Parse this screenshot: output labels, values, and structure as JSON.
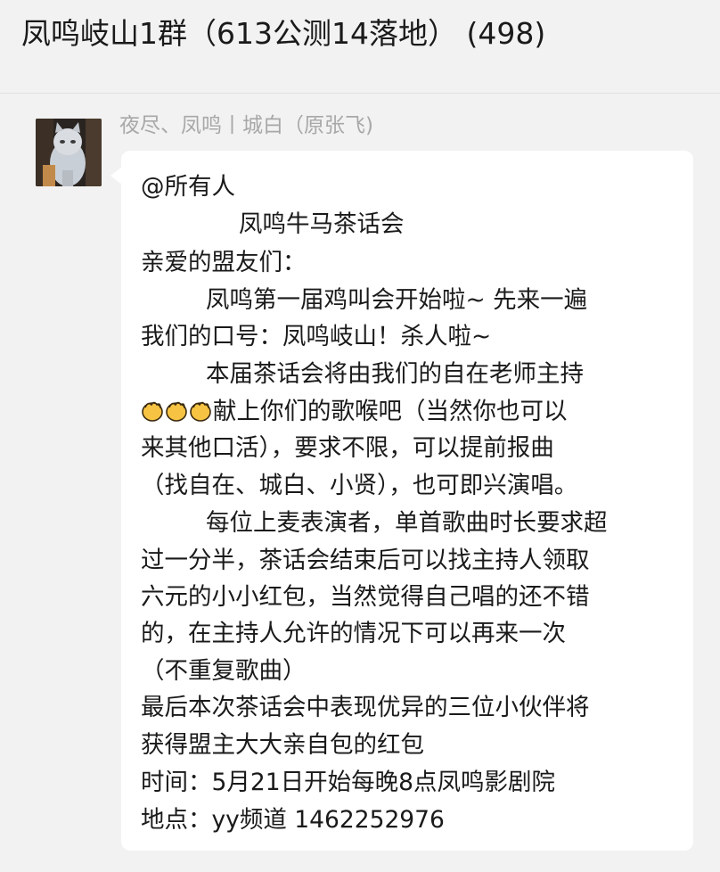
{
  "header": {
    "title": "凤鸣岐山1群（613公测14落地） (498)"
  },
  "message": {
    "sender": "夜尽、凤鸣丨城白（原张飞)",
    "avatar_icon": "cat-avatar",
    "clap_icon": "clapping-hands-emoji",
    "lines": [
      "@所有人",
      "凤鸣牛马茶话会",
      "亲爱的盟友们：",
      "凤鸣第一届鸡叫会开始啦~  先来一遍",
      "我们的口号：凤鸣岐山！杀人啦~",
      "本届茶话会将由我们的自在老师主持",
      "献上你们的歌喉吧（当然你也可以",
      "来其他口活），要求不限，可以提前报曲",
      "（找自在、城白、小贤），也可即兴演唱。",
      "每位上麦表演者，单首歌曲时长要求超",
      "过一分半，茶话会结束后可以找主持人领取",
      "六元的小小红包，当然觉得自己唱的还不错",
      "的，在主持人允许的情况下可以再来一次",
      "（不重复歌曲）",
      "最后本次茶话会中表现优异的三位小伙伴将",
      "获得盟主大大亲自包的红包",
      "时间：5月21日开始每晚8点凤鸣影剧院",
      "地点：yy频道  1462252976"
    ]
  },
  "colors": {
    "background": "#f2f2f2",
    "bubble": "#ffffff",
    "sender_text": "#a8a8a8",
    "message_text": "#1a1a1a",
    "clap_yellow": "#f6c343"
  }
}
